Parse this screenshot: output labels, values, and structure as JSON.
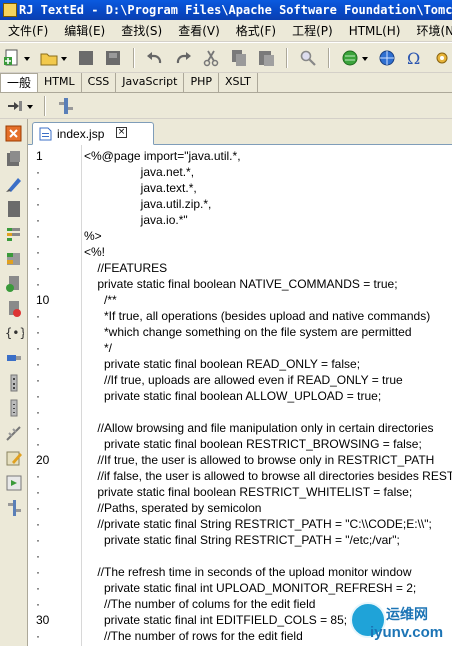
{
  "window": {
    "title": "RJ TextEd - D:\\Program Files\\Apache Software Foundation\\Tomcat"
  },
  "menu": [
    "文件(F)",
    "编辑(E)",
    "查找(S)",
    "查看(V)",
    "格式(F)",
    "工程(P)",
    "HTML(H)",
    "环境(N)"
  ],
  "clip_tabs": [
    "一般",
    "HTML",
    "CSS",
    "JavaScript",
    "PHP",
    "XSLT"
  ],
  "document_tab": {
    "filename": "index.jsp",
    "close_glyph": "×"
  },
  "line_numbers": [
    "1",
    "·",
    "·",
    "·",
    "·",
    "·",
    "·",
    "·",
    "·",
    "10",
    "·",
    "·",
    "·",
    "·",
    "·",
    "·",
    "·",
    "·",
    "·",
    "20",
    "·",
    "·",
    "·",
    "·",
    "·",
    "·",
    "·",
    "·",
    "·",
    "30",
    "·"
  ],
  "code_lines": [
    "<%@page import=\"java.util.*,",
    "                 java.net.*,",
    "                 java.text.*,",
    "                 java.util.zip.*,",
    "                 java.io.*\"",
    "%>",
    "<%!",
    "    //FEATURES",
    "    private static final boolean NATIVE_COMMANDS = true;",
    "      /**",
    "      *If true, all operations (besides upload and native commands)",
    "      *which change something on the file system are permitted",
    "      */",
    "      private static final boolean READ_ONLY = false;",
    "      //If true, uploads are allowed even if READ_ONLY = true",
    "      private static final boolean ALLOW_UPLOAD = true;",
    "",
    "    //Allow browsing and file manipulation only in certain directories",
    "      private static final boolean RESTRICT_BROWSING = false;",
    "    //If true, the user is allowed to browse only in RESTRICT_PATH",
    "    //if false, the user is allowed to browse all directories besides RESTRICT_PATH",
    "    private static final boolean RESTRICT_WHITELIST = false;",
    "    //Paths, sperated by semicolon",
    "    //private static final String RESTRICT_PATH = \"C:\\\\CODE;E:\\\\\";",
    "      private static final String RESTRICT_PATH = \"/etc;/var\";",
    "",
    "    //The refresh time in seconds of the upload monitor window",
    "      private static final int UPLOAD_MONITOR_REFRESH = 2;",
    "      //The number of colums for the edit field",
    "      private static final int EDITFIELD_COLS = 85;",
    "      //The number of rows for the edit field"
  ],
  "icons": {
    "toolbar": [
      "new-file-icon",
      "open-folder-icon",
      "save-icon",
      "save-all-icon",
      "undo-icon",
      "redo-icon",
      "cut-icon",
      "copy-icon",
      "paste-icon",
      "find-icon",
      "globe-icon",
      "web-icon",
      "omega-icon",
      "settings-icon"
    ],
    "sidebar": [
      "close-panel-icon",
      "file-explorer-icon",
      "brush-icon",
      "document-icon",
      "outline-icon",
      "project-icon",
      "add-document-icon",
      "remove-document-icon",
      "braces-icon",
      "tag-icon",
      "indent-icon",
      "list-icon",
      "wand-icon",
      "edit-icon",
      "preview-icon",
      "tools-icon"
    ]
  },
  "watermark": {
    "text_cn": "运维网",
    "text_en": "iyunv.com"
  }
}
